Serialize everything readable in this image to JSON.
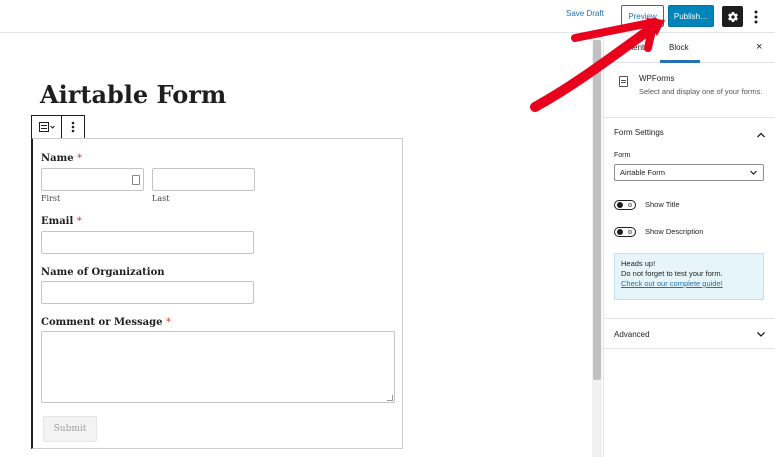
{
  "topbar": {
    "save_draft": "Save Draft",
    "preview": "Preview",
    "publish": "Publish…"
  },
  "editor": {
    "post_title": "Airtable Form"
  },
  "form": {
    "name_label": "Name",
    "required_mark": "*",
    "first_sublabel": "First",
    "last_sublabel": "Last",
    "email_label": "Email",
    "organization_label": "Name of Organization",
    "comment_label": "Comment or Message",
    "submit_label": "Submit"
  },
  "sidebar": {
    "tab_document": "ument",
    "tab_block": "Block",
    "close": "×",
    "block_card": {
      "title": "WPForms",
      "description": "Select and display one of your forms."
    },
    "form_settings": {
      "title": "Form Settings",
      "form_label": "Form",
      "form_selected": "Airtable Form",
      "show_title": "Show Title",
      "show_description": "Show Description",
      "notice_heading": "Heads up!",
      "notice_text": "Do not forget to test your form.",
      "notice_link": "Check out our complete guide!"
    },
    "advanced": {
      "title": "Advanced"
    }
  },
  "colors": {
    "accent": "#2271b1",
    "publish_bg": "#0085ba",
    "required": "#d63638",
    "notice_bg": "#e5f5fa",
    "annotation_arrow": "#e8001c"
  }
}
